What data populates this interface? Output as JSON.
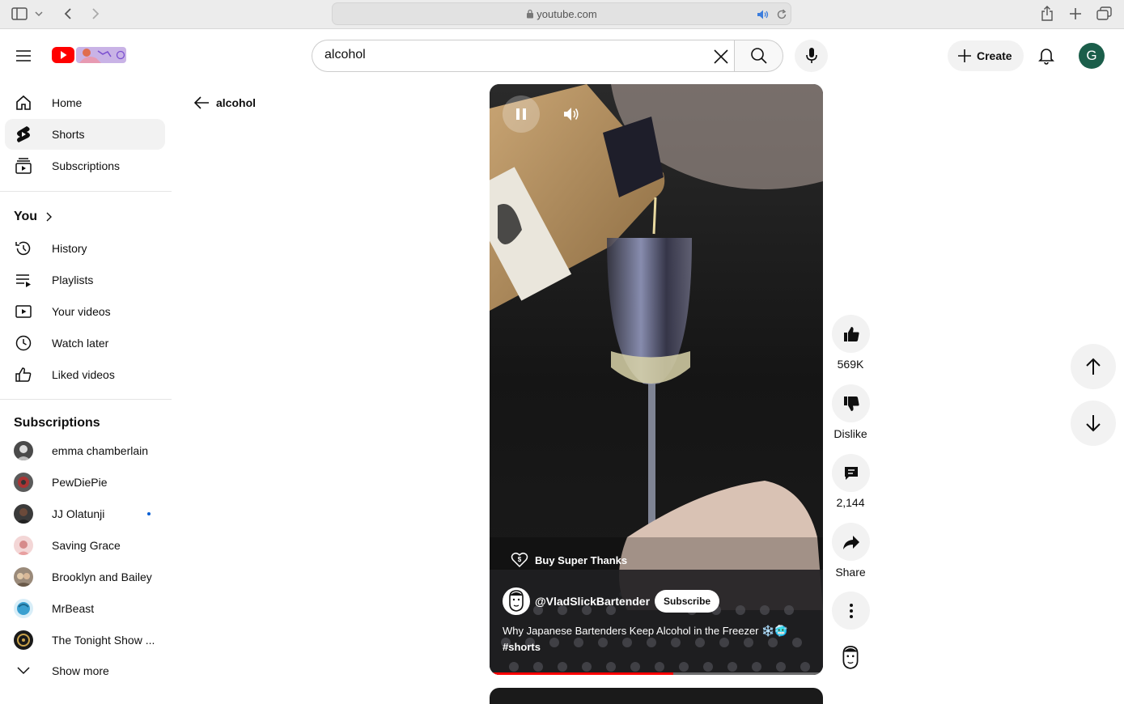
{
  "browser": {
    "url": "youtube.com"
  },
  "header": {
    "search": {
      "value": "alcohol"
    },
    "create_label": "Create",
    "avatar_letter": "G",
    "brand_color": "#ff0000",
    "avatar_color": "#1b5e4a"
  },
  "sidebar": {
    "main": [
      {
        "label": "Home",
        "icon": "home-icon"
      },
      {
        "label": "Shorts",
        "icon": "shorts-icon",
        "active": true
      },
      {
        "label": "Subscriptions",
        "icon": "subscriptions-icon"
      }
    ],
    "you_heading": "You",
    "you_items": [
      {
        "label": "History",
        "icon": "history-icon"
      },
      {
        "label": "Playlists",
        "icon": "playlists-icon"
      },
      {
        "label": "Your videos",
        "icon": "your-videos-icon"
      },
      {
        "label": "Watch later",
        "icon": "watch-later-icon"
      },
      {
        "label": "Liked videos",
        "icon": "liked-videos-icon"
      }
    ],
    "subscriptions_heading": "Subscriptions",
    "subscriptions": [
      {
        "label": "emma chamberlain",
        "color": "#4a4a4a"
      },
      {
        "label": "PewDiePie",
        "color": "#7a2a2a"
      },
      {
        "label": "JJ Olatunji",
        "color": "#3a3a3a",
        "new": true
      },
      {
        "label": "Saving Grace",
        "color": "#d9a0a0"
      },
      {
        "label": "Brooklyn and Bailey",
        "color": "#8a7a6a"
      },
      {
        "label": "MrBeast",
        "color": "#3aa0d0"
      },
      {
        "label": "The Tonight Show ...",
        "color": "#1a1a1a"
      }
    ],
    "show_more_label": "Show more"
  },
  "back_query": "alcohol",
  "short": {
    "super_thanks_label": "Buy Super Thanks",
    "channel": "@VladSlickBartender",
    "subscribe_label": "Subscribe",
    "title": "Why Japanese Bartenders Keep Alcohol in the Freezer ❄️🥶",
    "hashtag": "#shorts",
    "progress": 0.55
  },
  "actions": {
    "likes": "569K",
    "dislike_label": "Dislike",
    "comments": "2,144",
    "share_label": "Share"
  }
}
